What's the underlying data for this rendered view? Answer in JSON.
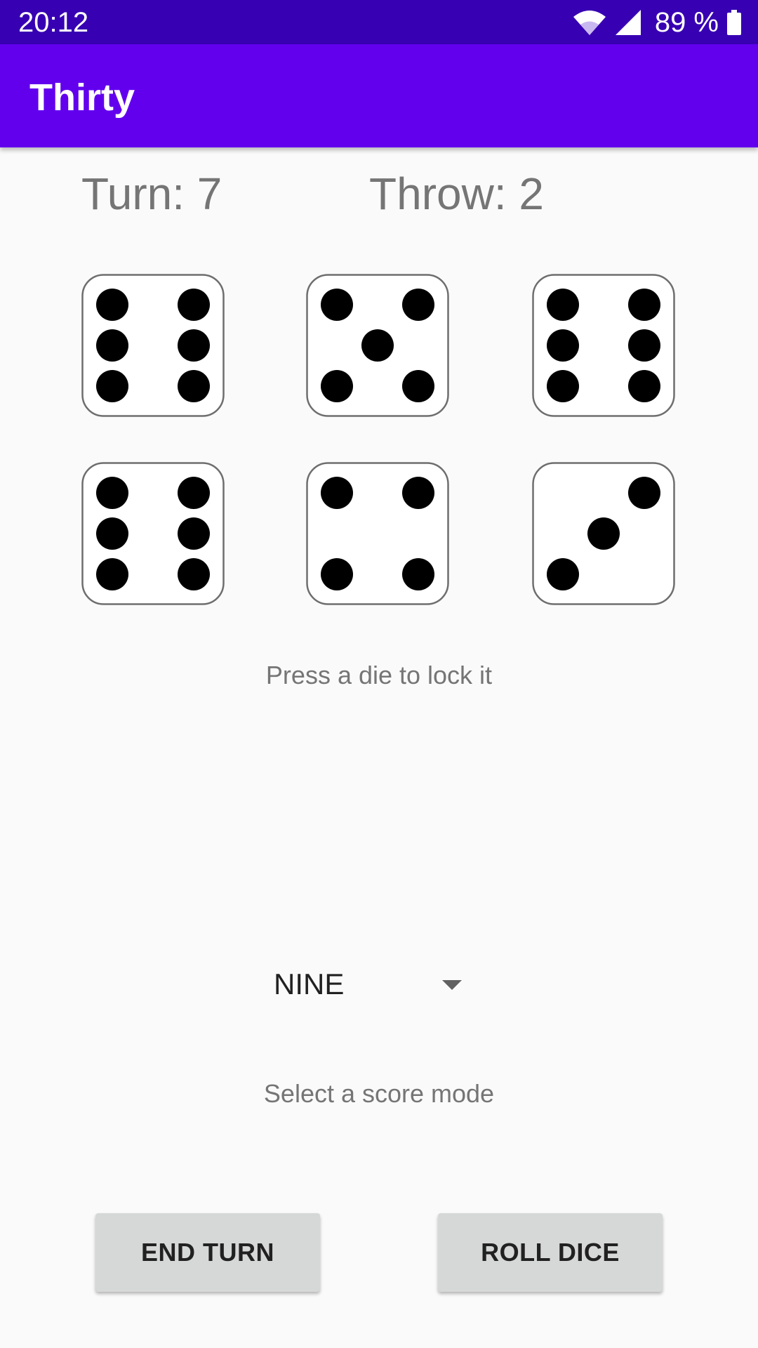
{
  "status_bar": {
    "time": "20:12",
    "battery": "89 %",
    "icons": [
      "wifi-icon",
      "signal-icon",
      "battery-icon"
    ]
  },
  "app_bar": {
    "title": "Thirty"
  },
  "game": {
    "turn_label": "Turn: 7",
    "throw_label": "Throw: 2",
    "dice": [
      6,
      5,
      6,
      6,
      4,
      3
    ],
    "lock_hint": "Press a die to lock it",
    "score_mode": {
      "selected": "NINE",
      "hint": "Select a score mode"
    }
  },
  "buttons": {
    "end_turn": "END TURN",
    "roll_dice": "ROLL DICE"
  },
  "colors": {
    "status_bar": "#3700B3",
    "app_bar": "#6200EE",
    "background": "#FAFAFA",
    "button": "#D6D7D7"
  }
}
